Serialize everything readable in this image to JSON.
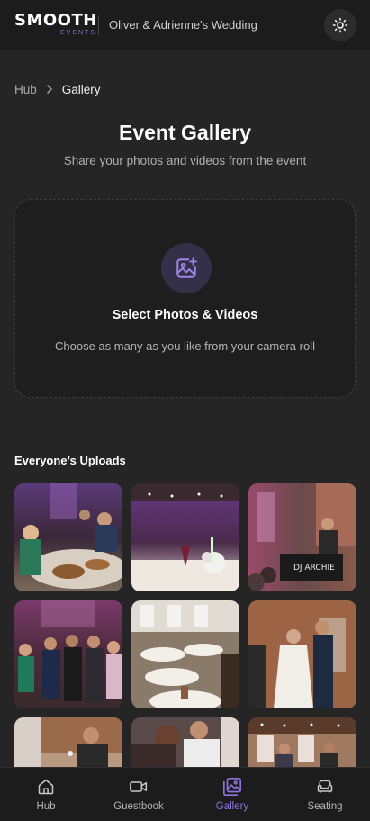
{
  "header": {
    "logo_main": "SMOOTH",
    "logo_sub": "EVENTS",
    "event_name": "Oliver & Adrienne's Wedding",
    "theme_icon": "sun-icon"
  },
  "breadcrumb": {
    "root": "Hub",
    "current": "Gallery"
  },
  "page": {
    "title": "Event Gallery",
    "subtitle": "Share your photos and videos from the event"
  },
  "upload": {
    "icon": "image-plus-icon",
    "title": "Select Photos & Videos",
    "description": "Choose as many as you like from your camera roll"
  },
  "uploads_section": {
    "title": "Everyone’s Uploads",
    "photo_count_visible": 9
  },
  "nav": {
    "items": [
      {
        "label": "Hub",
        "icon": "home-icon",
        "active": false
      },
      {
        "label": "Guestbook",
        "icon": "video-icon",
        "active": false
      },
      {
        "label": "Gallery",
        "icon": "gallery-icon",
        "active": true
      },
      {
        "label": "Seating",
        "icon": "sofa-icon",
        "active": false
      }
    ]
  },
  "colors": {
    "accent": "#8f72e0",
    "background": "#252525",
    "header": "#1c1c1c"
  }
}
